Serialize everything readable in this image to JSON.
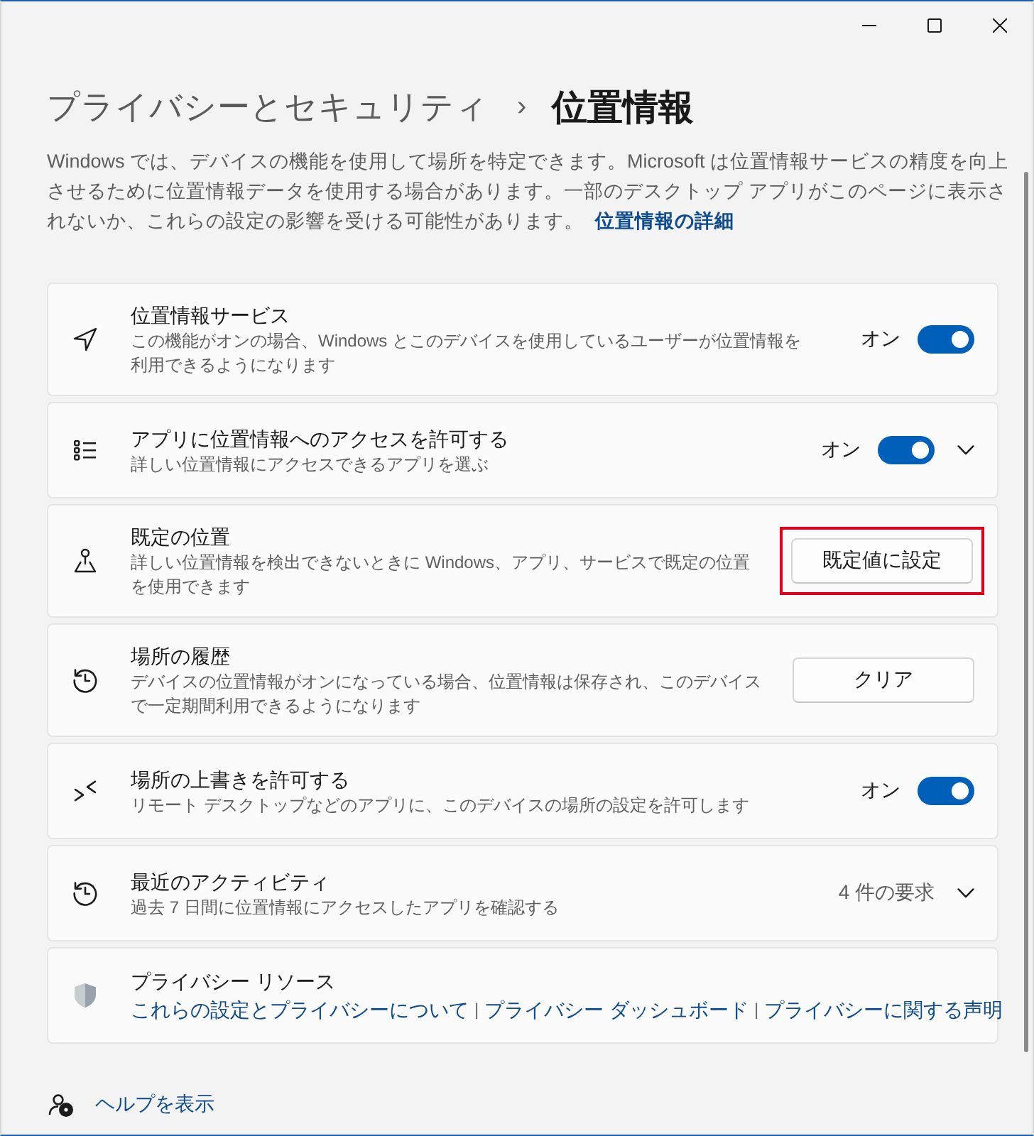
{
  "breadcrumb": {
    "parent": "プライバシーとセキュリティ",
    "separator": "›",
    "current": "位置情報"
  },
  "intro": {
    "text": "Windows では、デバイスの機能を使用して場所を特定できます。Microsoft は位置情報サービスの精度を向上させるために位置情報データを使用する場合があります。一部のデスクトップ アプリがこのページに表示されないか、これらの設定の影響を受ける可能性があります。",
    "link": "位置情報の詳細"
  },
  "settings": [
    {
      "kind": "toggle",
      "title": "位置情報サービス",
      "description": "この機能がオンの場合、Windows とこのデバイスを使用しているユーザーが位置情報を利用できるようになります",
      "state_label": "オン",
      "on": true
    },
    {
      "kind": "toggle",
      "title": "アプリに位置情報へのアクセスを許可する",
      "description": "詳しい位置情報にアクセスできるアプリを選ぶ",
      "state_label": "オン",
      "on": true,
      "expanded": false
    },
    {
      "kind": "button",
      "title": "既定の位置",
      "description": "詳しい位置情報を検出できないときに Windows、アプリ、サービスで既定の位置を使用できます",
      "button": "既定値に設定",
      "highlighted": true
    },
    {
      "kind": "button",
      "title": "場所の履歴",
      "description": "デバイスの位置情報がオンになっている場合、位置情報は保存され、このデバイスで一定期間利用できるようになります",
      "button": "クリア",
      "highlighted": false
    },
    {
      "kind": "toggle",
      "title": "場所の上書きを許可する",
      "description": "リモート デスクトップなどのアプリに、このデバイスの場所の設定を許可します",
      "state_label": "オン",
      "on": true
    },
    {
      "kind": "summary",
      "title": "最近のアクティビティ",
      "description": "過去 7 日間に位置情報にアクセスしたアプリを確認する",
      "summary": "4 件の要求",
      "expanded": false
    },
    {
      "kind": "links",
      "title": "プライバシー リソース",
      "links": [
        "これらの設定とプライバシーについて",
        "プライバシー ダッシュボード",
        "プライバシーに関する声明"
      ],
      "separator": "|"
    }
  ],
  "help": {
    "link": "ヘルプを表示"
  }
}
